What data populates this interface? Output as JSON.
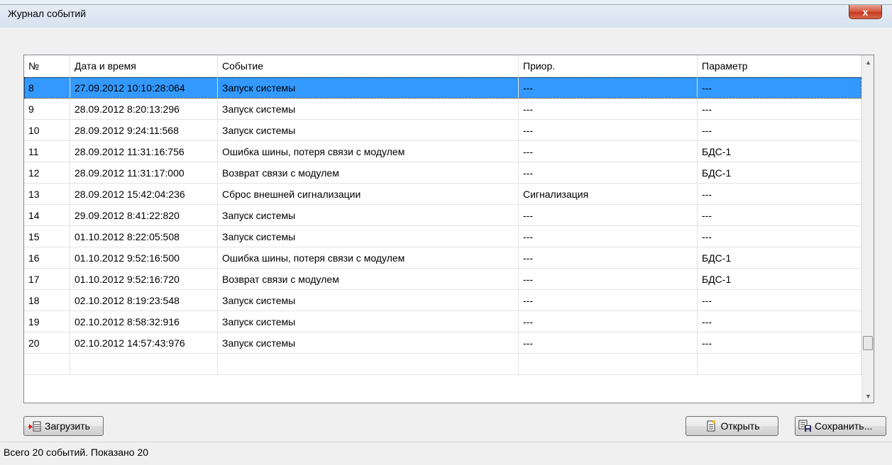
{
  "window": {
    "title": "Журнал событий",
    "close_glyph": "x"
  },
  "table": {
    "columns": [
      "№",
      "Дата и время",
      "Событие",
      "Приор.",
      "Параметр"
    ],
    "selected_row": 0,
    "rows": [
      [
        "8",
        "27.09.2012 10:10:28:064",
        "Запуск системы",
        "---",
        "---"
      ],
      [
        "9",
        "28.09.2012 8:20:13:296",
        "Запуск системы",
        "---",
        "---"
      ],
      [
        "10",
        "28.09.2012 9:24:11:568",
        "Запуск системы",
        "---",
        "---"
      ],
      [
        "11",
        "28.09.2012 11:31:16:756",
        "Ошибка шины, потеря связи с модулем",
        "---",
        "БДС-1"
      ],
      [
        "12",
        "28.09.2012 11:31:17:000",
        "Возврат связи с модулем",
        "---",
        "БДС-1"
      ],
      [
        "13",
        "28.09.2012 15:42:04:236",
        "Сброс внешней сигнализации",
        "Сигнализация",
        "---"
      ],
      [
        "14",
        "29.09.2012 8:41:22:820",
        "Запуск системы",
        "---",
        "---"
      ],
      [
        "15",
        "01.10.2012 8:22:05:508",
        "Запуск системы",
        "---",
        "---"
      ],
      [
        "16",
        "01.10.2012 9:52:16:500",
        "Ошибка шины, потеря связи с модулем",
        "---",
        "БДС-1"
      ],
      [
        "17",
        "01.10.2012 9:52:16:720",
        "Возврат связи с модулем",
        "---",
        "БДС-1"
      ],
      [
        "18",
        "02.10.2012 8:19:23:548",
        "Запуск системы",
        "---",
        "---"
      ],
      [
        "19",
        "02.10.2012 8:58:32:916",
        "Запуск системы",
        "---",
        "---"
      ],
      [
        "20",
        "02.10.2012 14:57:43:976",
        "Запуск системы",
        "---",
        "---"
      ]
    ]
  },
  "scrollbar": {
    "up_glyph": "▲",
    "down_glyph": "▼",
    "position_fraction": 0.87
  },
  "buttons": {
    "load": {
      "label": "Загрузить",
      "icon": "load-table-icon"
    },
    "open": {
      "label": "Открыть",
      "icon": "document-icon"
    },
    "save": {
      "label": "Сохранить...",
      "icon": "save-table-icon"
    }
  },
  "status": {
    "text": "Всего 20 событий. Показано 20"
  },
  "colors": {
    "selection": "#3399ff",
    "close_button": "#c7381f",
    "grid_line": "#e3e3e3"
  }
}
